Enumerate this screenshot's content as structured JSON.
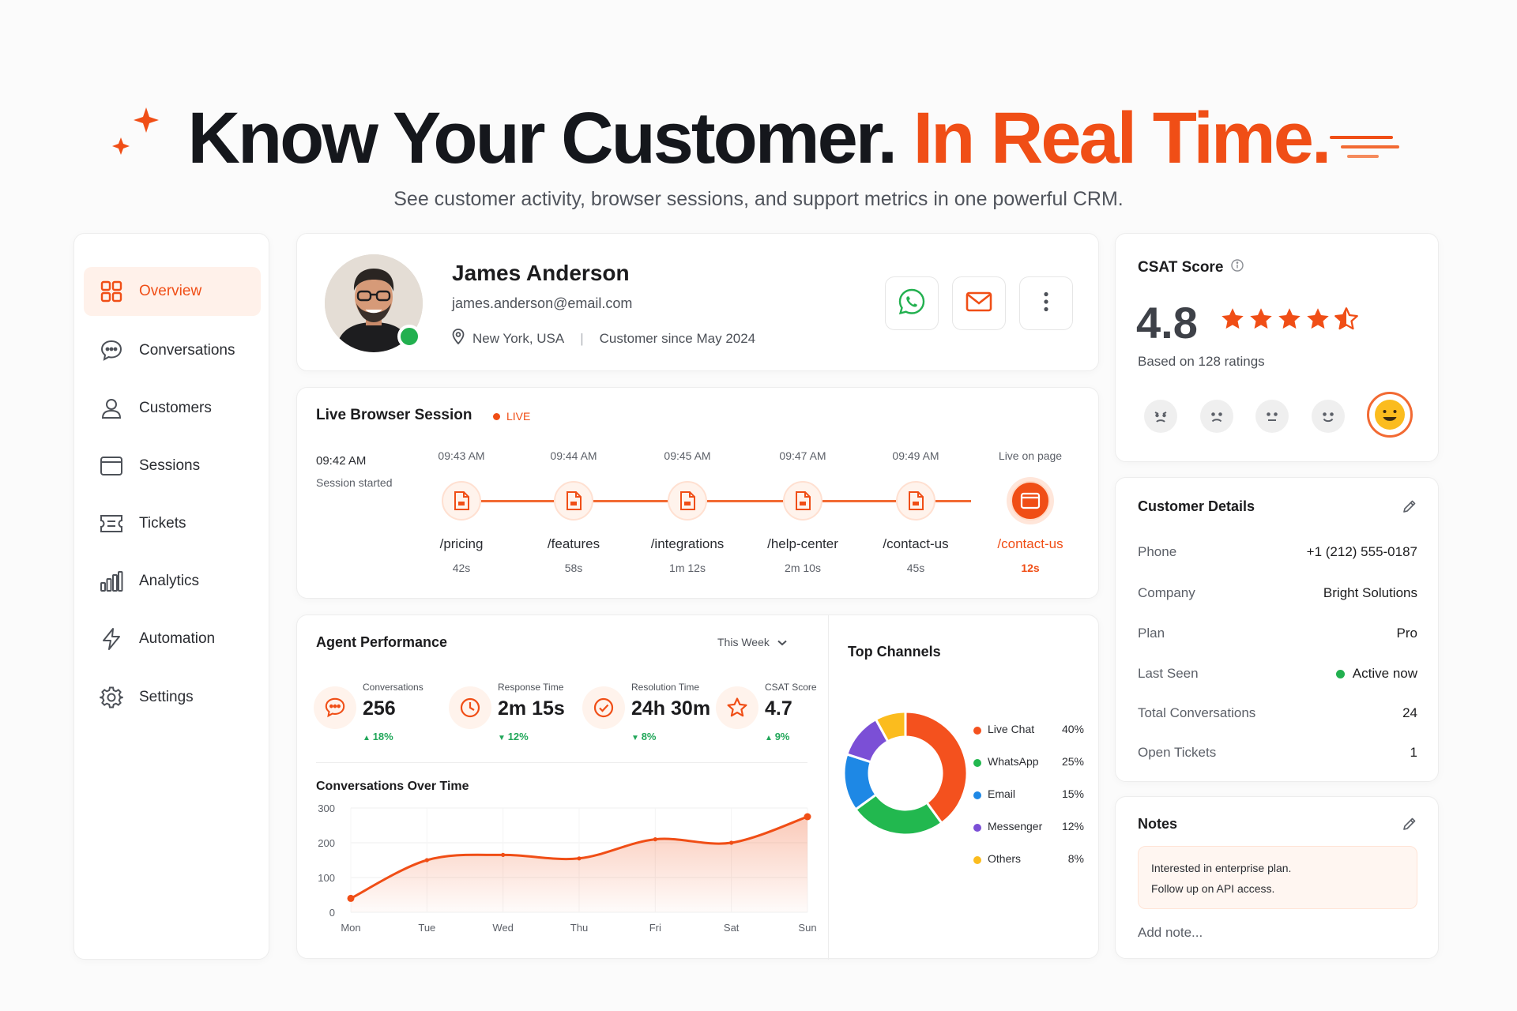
{
  "hero": {
    "title_main": "Know Your Customer.",
    "title_accent": "In Real Time.",
    "subtitle": "See customer activity, browser sessions, and support metrics in one powerful CRM."
  },
  "sidebar": {
    "items": [
      {
        "label": "Overview",
        "icon": "grid-icon",
        "active": true
      },
      {
        "label": "Conversations",
        "icon": "chat-bubble-icon"
      },
      {
        "label": "Customers",
        "icon": "user-icon"
      },
      {
        "label": "Sessions",
        "icon": "browser-window-icon"
      },
      {
        "label": "Tickets",
        "icon": "ticket-icon"
      },
      {
        "label": "Analytics",
        "icon": "bar-chart-icon"
      },
      {
        "label": "Automation",
        "icon": "lightning-icon"
      },
      {
        "label": "Settings",
        "icon": "gear-icon"
      }
    ]
  },
  "profile": {
    "name": "James Anderson",
    "email": "james.anderson@email.com",
    "location": "New York, USA",
    "separator": "|",
    "since": "Customer since May 2024",
    "actions": [
      "whatsapp-icon",
      "mail-icon",
      "more-vertical-icon"
    ]
  },
  "session": {
    "title": "Live Browser Session",
    "live_label": "LIVE",
    "start_time": "09:42 AM",
    "start_label": "Session started",
    "steps": [
      {
        "time": "09:43 AM",
        "page": "/pricing",
        "duration": "42s"
      },
      {
        "time": "09:44 AM",
        "page": "/features",
        "duration": "58s"
      },
      {
        "time": "09:45 AM",
        "page": "/integrations",
        "duration": "1m 12s"
      },
      {
        "time": "09:47 AM",
        "page": "/help-center",
        "duration": "2m 10s"
      },
      {
        "time": "09:49 AM",
        "page": "/contact-us",
        "duration": "45s"
      },
      {
        "time": "Live on page",
        "page": "/contact-us",
        "duration": "12s",
        "current": true
      }
    ]
  },
  "performance": {
    "title": "Agent Performance",
    "period": "This Week",
    "metrics": [
      {
        "label": "Conversations",
        "value": "256",
        "change": "18%",
        "direction": "up",
        "icon": "chat-bubble-icon"
      },
      {
        "label": "Response Time",
        "value": "2m 15s",
        "change": "12%",
        "direction": "down",
        "icon": "clock-icon"
      },
      {
        "label": "Resolution Time",
        "value": "24h 30m",
        "change": "8%",
        "direction": "down",
        "icon": "check-circle-icon"
      },
      {
        "label": "CSAT Score",
        "value": "4.7",
        "change": "9%",
        "direction": "up",
        "icon": "star-icon"
      }
    ]
  },
  "chart_data": [
    {
      "type": "area",
      "title": "Conversations Over Time",
      "categories": [
        "Mon",
        "Tue",
        "Wed",
        "Thu",
        "Fri",
        "Sat",
        "Sun"
      ],
      "values": [
        40,
        150,
        165,
        155,
        210,
        200,
        275
      ],
      "ylim": [
        0,
        300
      ],
      "yticks": [
        "0",
        "100",
        "200",
        "300"
      ],
      "xlabel": "",
      "ylabel": "",
      "grid": true,
      "color": "#f04e16"
    },
    {
      "type": "pie",
      "title": "Top Channels",
      "categories": [
        "Live Chat",
        "WhatsApp",
        "Email",
        "Messenger",
        "Others"
      ],
      "values": [
        40,
        25,
        15,
        12,
        8
      ],
      "value_labels": [
        "40%",
        "25%",
        "15%",
        "12%",
        "8%"
      ],
      "colors": [
        "#f4511e",
        "#22b84f",
        "#1e88e5",
        "#7b4fd6",
        "#fbbc1e"
      ],
      "legend": "right"
    }
  ],
  "csat": {
    "title": "CSAT Score",
    "score": "4.8",
    "rating": 4.5,
    "based_on": "Based on 128 ratings",
    "faces": [
      "angry-face-icon",
      "sad-face-icon",
      "neutral-face-icon",
      "smile-face-icon",
      "happy-face-icon"
    ],
    "selected": 4
  },
  "details": {
    "title": "Customer Details",
    "rows": [
      {
        "label": "Phone",
        "value": "+1 (212) 555-0187"
      },
      {
        "label": "Company",
        "value": "Bright Solutions"
      },
      {
        "label": "Plan",
        "value": "Pro"
      },
      {
        "label": "Last Seen",
        "value": "Active now",
        "status": "online"
      },
      {
        "label": "Total Conversations",
        "value": "24"
      },
      {
        "label": "Open Tickets",
        "value": "1"
      }
    ]
  },
  "notes": {
    "title": "Notes",
    "lines": [
      "Interested in enterprise plan.",
      "Follow up on API access."
    ],
    "add_placeholder": "Add note..."
  },
  "colors": {
    "accent": "#f04e16",
    "positive": "#22a75a",
    "online": "#22b04f"
  }
}
